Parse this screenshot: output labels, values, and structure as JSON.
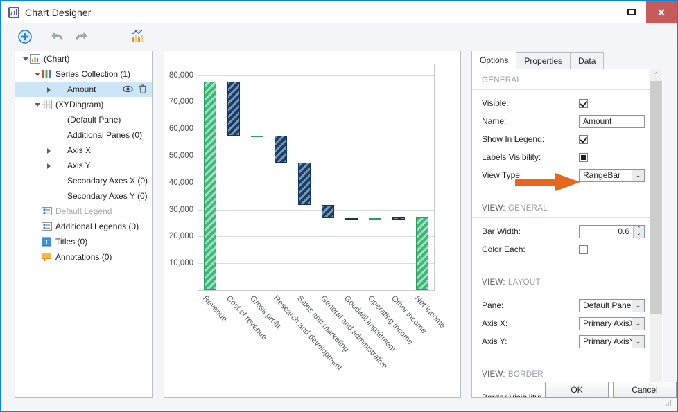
{
  "window": {
    "title": "Chart Designer",
    "app_icon": "chart-app-icon",
    "restore_label": "Restore",
    "close_label": "Close"
  },
  "toolbar": {
    "items": [
      {
        "name": "add-series-button",
        "icon": "add-circle-icon",
        "tooltip": "Add"
      },
      {
        "name": "undo-button",
        "icon": "undo-arrow-icon",
        "tooltip": "Undo"
      },
      {
        "name": "redo-button",
        "icon": "redo-arrow-icon",
        "tooltip": "Redo"
      },
      {
        "name": "chart-wizard-button",
        "icon": "chart-wizard-icon",
        "tooltip": "Chart Wizard"
      }
    ]
  },
  "tree": {
    "nodes": [
      {
        "label": "(Chart)",
        "indent": 0,
        "expander": "open",
        "icon": "chart-icon",
        "selected": false,
        "dim": false
      },
      {
        "label": "Series Collection (1)",
        "indent": 1,
        "expander": "open",
        "icon": "series-icon",
        "selected": false,
        "dim": false
      },
      {
        "label": "Amount",
        "indent": 2,
        "expander": "closed",
        "icon": "none",
        "selected": true,
        "dim": false
      },
      {
        "label": "(XYDiagram)",
        "indent": 1,
        "expander": "open",
        "icon": "diagram-grid-icon",
        "selected": false,
        "dim": false
      },
      {
        "label": "(Default Pane)",
        "indent": 2,
        "expander": "none",
        "icon": "none",
        "selected": false,
        "dim": false
      },
      {
        "label": "Additional Panes (0)",
        "indent": 2,
        "expander": "none",
        "icon": "none",
        "selected": false,
        "dim": false
      },
      {
        "label": "Axis X",
        "indent": 2,
        "expander": "closed",
        "icon": "none",
        "selected": false,
        "dim": false
      },
      {
        "label": "Axis Y",
        "indent": 2,
        "expander": "closed",
        "icon": "none",
        "selected": false,
        "dim": false
      },
      {
        "label": "Secondary Axes X (0)",
        "indent": 2,
        "expander": "none",
        "icon": "none",
        "selected": false,
        "dim": false
      },
      {
        "label": "Secondary Axes Y (0)",
        "indent": 2,
        "expander": "none",
        "icon": "none",
        "selected": false,
        "dim": false
      },
      {
        "label": "Default Legend",
        "indent": 1,
        "expander": "none",
        "icon": "legend-icon",
        "selected": false,
        "dim": true
      },
      {
        "label": "Additional Legends (0)",
        "indent": 1,
        "expander": "none",
        "icon": "legend-icon",
        "selected": false,
        "dim": false
      },
      {
        "label": "Titles (0)",
        "indent": 1,
        "expander": "none",
        "icon": "title-icon",
        "selected": false,
        "dim": false
      },
      {
        "label": "Annotations (0)",
        "indent": 1,
        "expander": "none",
        "icon": "annotation-icon",
        "selected": false,
        "dim": false
      }
    ],
    "row_actions": {
      "visibility_icon": "eye-icon",
      "delete_icon": "trash-icon"
    }
  },
  "chart_data": {
    "type": "bar",
    "title": "",
    "xlabel": "",
    "ylabel": "",
    "ylim": [
      0,
      84000
    ],
    "grid": true,
    "legend": false,
    "yticks": [
      10000,
      20000,
      30000,
      40000,
      50000,
      60000,
      70000,
      80000
    ],
    "ytick_labels": [
      "10,000",
      "20,000",
      "30,000",
      "40,000",
      "50,000",
      "60,000",
      "70,000",
      "80,000"
    ],
    "categories": [
      "Revenue",
      "Cost of revenue",
      "Gross profit",
      "Research and development",
      "Sales and marketing",
      "General and administrative",
      "Goodwill impairment",
      "Operating income",
      "Other income",
      "Net Income"
    ],
    "series": [
      {
        "name": "Amount",
        "kind": "range-bar-waterfall",
        "points": [
          {
            "category": "Revenue",
            "low": 0,
            "high": 77600,
            "color": "green"
          },
          {
            "category": "Cost of revenue",
            "low": 57500,
            "high": 77600,
            "color": "navy"
          },
          {
            "category": "Gross profit",
            "low": 57400,
            "high": 57500,
            "color": "green"
          },
          {
            "category": "Research and development",
            "low": 47400,
            "high": 57500,
            "color": "navy"
          },
          {
            "category": "Sales and marketing",
            "low": 31800,
            "high": 47400,
            "color": "navy"
          },
          {
            "category": "General and administrative",
            "low": 26800,
            "high": 31800,
            "color": "navy"
          },
          {
            "category": "Goodwill impairment",
            "low": 26700,
            "high": 26800,
            "color": "navy"
          },
          {
            "category": "Operating income",
            "low": 26700,
            "high": 26800,
            "color": "green"
          },
          {
            "category": "Other income",
            "low": 26800,
            "high": 27000,
            "color": "navy"
          },
          {
            "category": "Net Income",
            "low": 0,
            "high": 27000,
            "color": "green"
          }
        ]
      }
    ],
    "colors": {
      "green": "#3cb878",
      "navy": "#163f6e"
    }
  },
  "options_panel": {
    "tabs": [
      {
        "label": "Options",
        "active": true
      },
      {
        "label": "Properties",
        "active": false
      },
      {
        "label": "Data",
        "active": false
      }
    ],
    "sections": [
      {
        "name": "general",
        "head_lead": "",
        "head_rest": "GENERAL",
        "rows": [
          {
            "label": "Visible:",
            "control": "checkbox",
            "state": "checked"
          },
          {
            "label": "Name:",
            "control": "textbox",
            "value": "Amount"
          },
          {
            "label": "Show In Legend:",
            "control": "checkbox",
            "state": "checked"
          },
          {
            "label": "Labels Visibility:",
            "control": "checkbox",
            "state": "indeterminate"
          },
          {
            "label": "View Type:",
            "control": "combo",
            "value": "RangeBar",
            "highlighted": true
          }
        ]
      },
      {
        "name": "view-general",
        "head_lead": "VIEW:",
        "head_rest": "GENERAL",
        "rows": [
          {
            "label": "Bar Width:",
            "control": "spinner",
            "value": "0.6"
          },
          {
            "label": "Color Each:",
            "control": "checkbox",
            "state": "unchecked"
          }
        ]
      },
      {
        "name": "view-layout",
        "head_lead": "VIEW:",
        "head_rest": "LAYOUT",
        "rows": [
          {
            "label": "Pane:",
            "control": "combo",
            "value": "Default Pane"
          },
          {
            "label": "Axis X:",
            "control": "combo",
            "value": "Primary AxisX"
          },
          {
            "label": "Axis Y:",
            "control": "combo",
            "value": "Primary AxisY"
          }
        ]
      },
      {
        "name": "view-border",
        "head_lead": "VIEW:",
        "head_rest": "BORDER",
        "rows": [
          {
            "label": "Border Visibility:",
            "control": "checkbox",
            "state": "indeterminate"
          }
        ]
      }
    ],
    "scrollbar": {
      "up_glyph": "⌃",
      "down_glyph": "⌄"
    },
    "combo_arrow_glyph": "⌄"
  },
  "annotation": {
    "arrow": "orange-right-arrow",
    "color": "#e8671c"
  },
  "footer": {
    "ok_label": "OK",
    "cancel_label": "Cancel"
  }
}
